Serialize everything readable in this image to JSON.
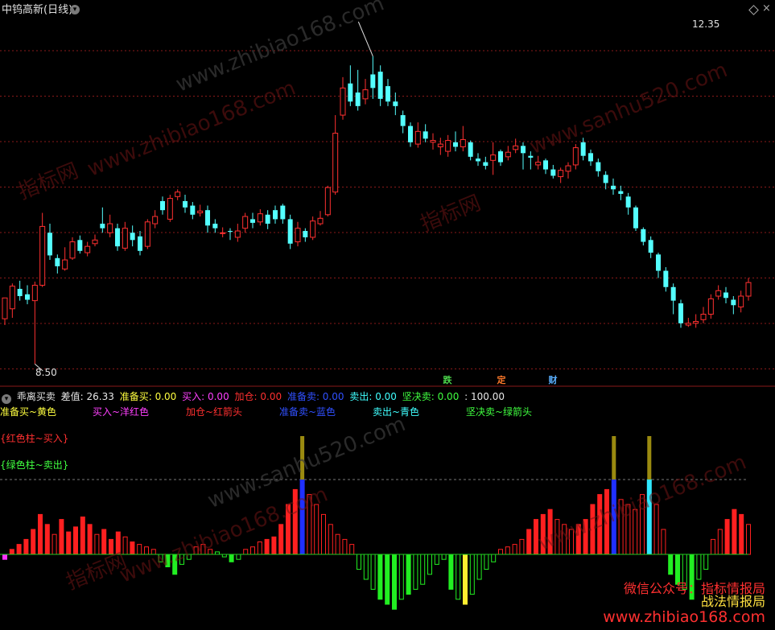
{
  "header": {
    "title": "中钨高新(日线)"
  },
  "price_labels": {
    "high": "12.35",
    "low": "8.50"
  },
  "events": [
    {
      "label": "跌",
      "color": "#4cd84c"
    },
    {
      "label": "定",
      "color": "#ff7a2a"
    },
    {
      "label": "财",
      "color": "#5ab0ff"
    }
  ],
  "indicator": {
    "name": "乖离买卖",
    "items": [
      {
        "label": "差值: 26.33",
        "color": "#e8e8e8"
      },
      {
        "label": "准备买: 0.00",
        "color": "#ffff40"
      },
      {
        "label": "买入: 0.00",
        "color": "#ff40ff"
      },
      {
        "label": "加仓: 0.00",
        "color": "#ff3030"
      },
      {
        "label": "准备卖: 0.00",
        "color": "#3050ff"
      },
      {
        "label": "卖出: 0.00",
        "color": "#40ffff"
      },
      {
        "label": "坚决卖: 0.00",
        "color": "#40ff40"
      },
      {
        "label": ": 100.00",
        "color": "#e8e8e8"
      }
    ]
  },
  "legend": [
    {
      "label": "准备买~黄色",
      "color": "#ffff40"
    },
    {
      "label": "买入~洋红色",
      "color": "#ff40ff"
    },
    {
      "label": "加仓~红箭头",
      "color": "#ff3030"
    },
    {
      "label": "准备卖~蓝色",
      "color": "#3050ff"
    },
    {
      "label": "卖出~青色",
      "color": "#40ffff"
    },
    {
      "label": "坚决卖~绿箭头",
      "color": "#40ff40"
    }
  ],
  "notes": {
    "red_bar": "{红色柱~买入}",
    "green_bar": "{绿色柱~卖出}"
  },
  "watermarks": {
    "site1": "www.zhibiao168.com",
    "site2": "www.sanhu520.com",
    "brand": "指标网"
  },
  "wechat": {
    "line1": "微信公众号：指标情报局",
    "line2": "战法情报局",
    "site": "www.zhibiao168.com"
  },
  "colors": {
    "up": "#ff3030",
    "down": "#54ffff",
    "grid": "#8a1a1a",
    "zero_line": "#22cc22"
  },
  "candles": [
    [
      9.05,
      9.28,
      9.13,
      8.98
    ],
    [
      9.16,
      9.41,
      9.44,
      9.06
    ],
    [
      9.38,
      9.3,
      9.47,
      9.25
    ],
    [
      9.32,
      9.26,
      9.42,
      9.21
    ],
    [
      9.25,
      9.42,
      9.46,
      8.55
    ],
    [
      9.42,
      10.07,
      10.22,
      9.4
    ],
    [
      10.0,
      9.75,
      10.1,
      9.7
    ],
    [
      9.72,
      9.63,
      9.76,
      9.55
    ],
    [
      9.6,
      9.7,
      9.84,
      9.58
    ],
    [
      9.72,
      9.9,
      9.95,
      9.7
    ],
    [
      9.92,
      9.8,
      9.97,
      9.77
    ],
    [
      9.78,
      9.85,
      9.9,
      9.74
    ],
    [
      9.88,
      9.92,
      9.98,
      9.85
    ],
    [
      10.1,
      10.05,
      10.28,
      10.0
    ],
    [
      10.0,
      10.1,
      10.2,
      9.95
    ],
    [
      10.05,
      9.85,
      10.1,
      9.8
    ],
    [
      9.83,
      10.05,
      10.12,
      9.8
    ],
    [
      10.0,
      9.92,
      10.08,
      9.85
    ],
    [
      9.96,
      9.8,
      10.02,
      9.75
    ],
    [
      9.85,
      10.12,
      10.15,
      9.82
    ],
    [
      10.1,
      10.18,
      10.25,
      10.05
    ],
    [
      10.35,
      10.25,
      10.4,
      10.2
    ],
    [
      10.15,
      10.38,
      10.42,
      10.12
    ],
    [
      10.4,
      10.45,
      10.48,
      10.36
    ],
    [
      10.35,
      10.28,
      10.42,
      10.22
    ],
    [
      10.3,
      10.2,
      10.34,
      10.15
    ],
    [
      10.22,
      10.24,
      10.31,
      10.18
    ],
    [
      10.25,
      10.08,
      10.3,
      10.0
    ],
    [
      10.1,
      10.05,
      10.15,
      10.0
    ],
    [
      10.0,
      10.0,
      10.06,
      9.95
    ],
    [
      10.02,
      10.01,
      10.05,
      9.92
    ],
    [
      9.95,
      10.02,
      10.1,
      9.9
    ],
    [
      10.05,
      10.18,
      10.22,
      10.0
    ],
    [
      10.15,
      10.11,
      10.22,
      10.05
    ],
    [
      10.12,
      10.21,
      10.26,
      10.08
    ],
    [
      10.2,
      10.1,
      10.25,
      10.04
    ],
    [
      10.25,
      10.15,
      10.3,
      10.1
    ],
    [
      10.3,
      10.15,
      10.32,
      10.1
    ],
    [
      10.15,
      9.88,
      10.2,
      9.82
    ],
    [
      9.9,
      10.05,
      10.12,
      9.85
    ],
    [
      10.02,
      9.95,
      10.05,
      9.9
    ],
    [
      9.95,
      10.13,
      10.18,
      9.92
    ],
    [
      10.1,
      10.16,
      10.24,
      10.08
    ],
    [
      10.2,
      10.5,
      10.52,
      10.18
    ],
    [
      10.45,
      11.1,
      11.3,
      10.42
    ],
    [
      11.3,
      11.6,
      11.72,
      11.25
    ],
    [
      11.65,
      11.45,
      11.85,
      11.4
    ],
    [
      11.55,
      11.4,
      11.8,
      11.35
    ],
    [
      11.48,
      11.58,
      11.7,
      11.42
    ],
    [
      11.75,
      11.6,
      11.95,
      11.48
    ],
    [
      11.78,
      11.48,
      11.85,
      11.4
    ],
    [
      11.62,
      11.45,
      11.7,
      11.4
    ],
    [
      11.45,
      11.4,
      11.55,
      11.3
    ],
    [
      11.3,
      11.18,
      11.35,
      11.1
    ],
    [
      11.18,
      11.0,
      11.22,
      10.95
    ],
    [
      10.98,
      11.12,
      11.22,
      10.94
    ],
    [
      11.12,
      11.04,
      11.2,
      11.0
    ],
    [
      11.0,
      11.02,
      11.1,
      10.92
    ],
    [
      10.95,
      10.98,
      11.05,
      10.86
    ],
    [
      10.9,
      11.02,
      11.08,
      10.84
    ],
    [
      11.0,
      10.95,
      11.12,
      10.9
    ],
    [
      10.95,
      11.03,
      11.18,
      10.9
    ],
    [
      11.0,
      10.84,
      11.02,
      10.8
    ],
    [
      10.82,
      10.79,
      10.88,
      10.74
    ],
    [
      10.78,
      10.74,
      10.84,
      10.7
    ],
    [
      10.8,
      10.86,
      11.0,
      10.64
    ],
    [
      10.9,
      10.78,
      10.92,
      10.74
    ],
    [
      10.84,
      10.89,
      10.96,
      10.8
    ],
    [
      10.92,
      10.96,
      11.04,
      10.88
    ],
    [
      10.96,
      10.88,
      11.0,
      10.7
    ],
    [
      10.85,
      10.83,
      10.9,
      10.7
    ],
    [
      10.75,
      10.78,
      10.85,
      10.7
    ],
    [
      10.8,
      10.7,
      10.82,
      10.65
    ],
    [
      10.7,
      10.63,
      10.75,
      10.6
    ],
    [
      10.62,
      10.69,
      10.72,
      10.55
    ],
    [
      10.68,
      10.74,
      10.78,
      10.6
    ],
    [
      10.75,
      10.94,
      10.98,
      10.7
    ],
    [
      11.0,
      10.85,
      11.05,
      10.8
    ],
    [
      10.88,
      10.79,
      10.92,
      10.74
    ],
    [
      10.78,
      10.68,
      10.82,
      10.62
    ],
    [
      10.64,
      10.55,
      10.68,
      10.48
    ],
    [
      10.52,
      10.48,
      10.6,
      10.42
    ],
    [
      10.46,
      10.43,
      10.52,
      10.36
    ],
    [
      10.4,
      10.28,
      10.44,
      10.2
    ],
    [
      10.28,
      10.05,
      10.3,
      10.02
    ],
    [
      10.04,
      9.9,
      10.06,
      9.86
    ],
    [
      9.92,
      9.78,
      9.96,
      9.72
    ],
    [
      9.76,
      9.58,
      9.78,
      9.5
    ],
    [
      9.58,
      9.4,
      9.62,
      9.35
    ],
    [
      9.4,
      9.25,
      9.44,
      9.1
    ],
    [
      9.22,
      9.0,
      9.26,
      8.95
    ],
    [
      8.98,
      9.0,
      9.06,
      8.96
    ],
    [
      9.0,
      9.02,
      9.1,
      8.95
    ],
    [
      9.04,
      9.1,
      9.18,
      9.0
    ],
    [
      9.1,
      9.27,
      9.32,
      9.05
    ],
    [
      9.3,
      9.36,
      9.42,
      9.26
    ],
    [
      9.34,
      9.28,
      9.4,
      9.22
    ],
    [
      9.26,
      9.2,
      9.3,
      9.1
    ],
    [
      9.18,
      9.3,
      9.36,
      9.12
    ],
    [
      9.3,
      9.45,
      9.5,
      9.25
    ]
  ],
  "indicator_bars": [
    [
      -2,
      "m"
    ],
    [
      2,
      "r"
    ],
    [
      4,
      "r"
    ],
    [
      6,
      "r"
    ],
    [
      10,
      "r"
    ],
    [
      16,
      "r"
    ],
    [
      12,
      "r"
    ],
    [
      8,
      "ro"
    ],
    [
      14,
      "r"
    ],
    [
      9,
      "r"
    ],
    [
      11,
      "r"
    ],
    [
      15,
      "r"
    ],
    [
      12,
      "r"
    ],
    [
      8,
      "ro"
    ],
    [
      10,
      "r"
    ],
    [
      6,
      "r"
    ],
    [
      9,
      "r"
    ],
    [
      7,
      "ro"
    ],
    [
      5,
      "r"
    ],
    [
      4,
      "ro"
    ],
    [
      3,
      "ro"
    ],
    [
      2,
      "ro"
    ],
    [
      -3,
      "go"
    ],
    [
      -5,
      "g"
    ],
    [
      -8,
      "g"
    ],
    [
      -4,
      "go"
    ],
    [
      -2,
      "go"
    ],
    [
      3,
      "ro"
    ],
    [
      4,
      "ro"
    ],
    [
      2,
      "ro"
    ],
    [
      1,
      "go"
    ],
    [
      -1,
      "go"
    ],
    [
      -3,
      "g"
    ],
    [
      -2,
      "go"
    ],
    [
      2,
      "ro"
    ],
    [
      3,
      "ro"
    ],
    [
      5,
      "ro"
    ],
    [
      6,
      "r"
    ],
    [
      7,
      "r"
    ],
    [
      12,
      "r"
    ],
    [
      20,
      "r"
    ],
    [
      26,
      "r"
    ],
    [
      30,
      "b"
    ],
    [
      24,
      "ro"
    ],
    [
      20,
      "ro"
    ],
    [
      16,
      "ro"
    ],
    [
      12,
      "ro"
    ],
    [
      8,
      "ro"
    ],
    [
      6,
      "ro"
    ],
    [
      4,
      "ro"
    ],
    [
      -6,
      "go"
    ],
    [
      -10,
      "go"
    ],
    [
      -14,
      "go"
    ],
    [
      -18,
      "g"
    ],
    [
      -20,
      "g"
    ],
    [
      -22,
      "g"
    ],
    [
      -18,
      "go"
    ],
    [
      -16,
      "g"
    ],
    [
      -14,
      "go"
    ],
    [
      -12,
      "go"
    ],
    [
      -8,
      "go"
    ],
    [
      -4,
      "go"
    ],
    [
      -2,
      "go"
    ],
    [
      -14,
      "g"
    ],
    [
      -18,
      "go"
    ],
    [
      -20,
      "y"
    ],
    [
      -16,
      "go"
    ],
    [
      -10,
      "go"
    ],
    [
      -6,
      "go"
    ],
    [
      -3,
      "go"
    ],
    [
      2,
      "ro"
    ],
    [
      3,
      "ro"
    ],
    [
      4,
      "ro"
    ],
    [
      6,
      "ro"
    ],
    [
      10,
      "r"
    ],
    [
      14,
      "r"
    ],
    [
      16,
      "r"
    ],
    [
      18,
      "r"
    ],
    [
      14,
      "ro"
    ],
    [
      12,
      "ro"
    ],
    [
      10,
      "ro"
    ],
    [
      12,
      "r"
    ],
    [
      14,
      "r"
    ],
    [
      20,
      "r"
    ],
    [
      24,
      "r"
    ],
    [
      26,
      "r"
    ],
    [
      30,
      "b"
    ],
    [
      22,
      "ro"
    ],
    [
      20,
      "ro"
    ],
    [
      18,
      "ro"
    ],
    [
      24,
      "ro"
    ],
    [
      30,
      "c"
    ],
    [
      20,
      "ro"
    ],
    [
      10,
      "ro"
    ],
    [
      -8,
      "g"
    ],
    [
      -12,
      "g"
    ],
    [
      -14,
      "go"
    ],
    [
      -18,
      "g"
    ],
    [
      -10,
      "go"
    ],
    [
      -6,
      "go"
    ],
    [
      6,
      "ro"
    ],
    [
      10,
      "ro"
    ],
    [
      14,
      "r"
    ],
    [
      18,
      "r"
    ],
    [
      16,
      "r"
    ],
    [
      12,
      "ro"
    ]
  ]
}
